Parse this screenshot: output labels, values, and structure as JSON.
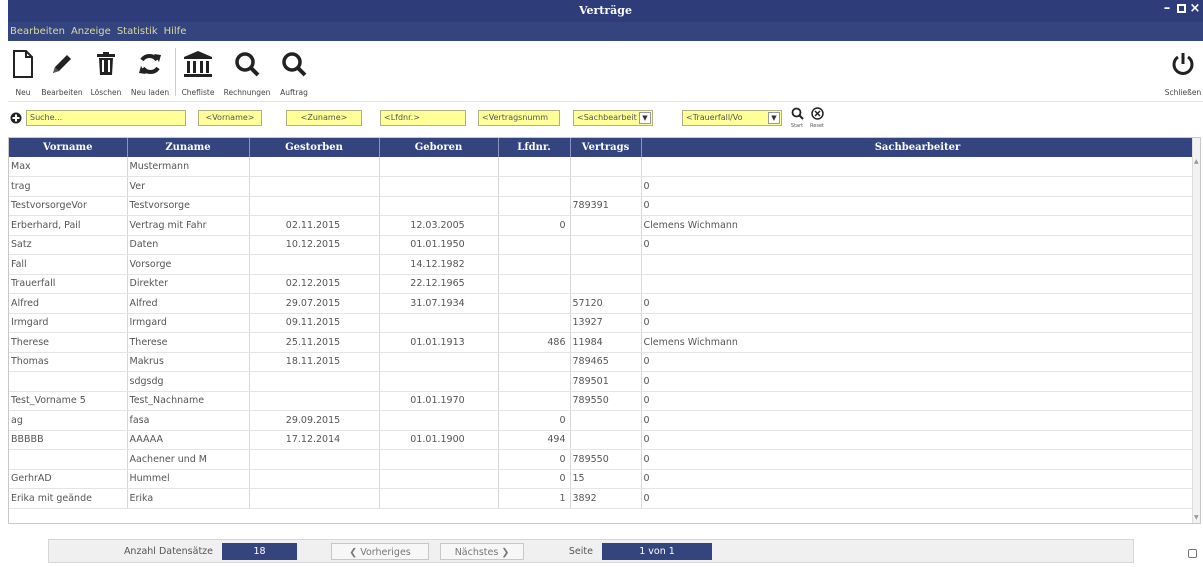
{
  "window": {
    "title": "Verträge"
  },
  "menu": [
    "Bearbeiten",
    "Anzeige",
    "Statistik",
    "Hilfe"
  ],
  "toolbar": {
    "new": "Neu",
    "edit": "Bearbeiten",
    "delete": "Löschen",
    "reload": "Neu laden",
    "chefliste": "Chefliste",
    "rechnungen": "Rechnungen",
    "auftrag": "Auftrag",
    "close": "Schließen"
  },
  "filters": {
    "search": "Suche...",
    "vorname": "<Vorname>",
    "zuname": "<Zuname>",
    "lfdnr": "<Lfdnr.>",
    "vertragsnummer": "<Vertragsnumm",
    "sachbearbeiter": "<Sachbearbeit",
    "trauerfall": "<Trauerfall/Vo",
    "start": "Start",
    "reset": "Reset"
  },
  "table": {
    "headers": [
      "Vorname",
      "Zuname",
      "Gestorben",
      "Geboren",
      "Lfdnr.",
      "Vertrags",
      "Sachbearbeiter"
    ],
    "rows": [
      [
        "Max",
        "Mustermann",
        "",
        "",
        "",
        "",
        ""
      ],
      [
        "trag",
        "Ver",
        "",
        "",
        "",
        "",
        "0"
      ],
      [
        "TestvorsorgeVor",
        "Testvorsorge",
        "",
        "",
        "",
        "789391",
        "0"
      ],
      [
        "Erberhard, Pail",
        "Vertrag mit Fahr",
        "02.11.2015",
        "12.03.2005",
        "0",
        "",
        "Clemens Wichmann"
      ],
      [
        "Satz",
        "Daten",
        "10.12.2015",
        "01.01.1950",
        "",
        "",
        "0"
      ],
      [
        "Fall",
        "Vorsorge",
        "",
        "14.12.1982",
        "",
        "",
        ""
      ],
      [
        "Trauerfall",
        "Direkter",
        "02.12.2015",
        "22.12.1965",
        "",
        "",
        ""
      ],
      [
        "Alfred",
        "Alfred",
        "29.07.2015",
        "31.07.1934",
        "",
        "57120",
        "0"
      ],
      [
        "Irmgard",
        "Irmgard",
        "09.11.2015",
        "",
        "",
        "13927",
        "0"
      ],
      [
        "Therese",
        "Therese",
        "25.11.2015",
        "01.01.1913",
        "486",
        "11984",
        "Clemens Wichmann"
      ],
      [
        "Thomas",
        "Makrus",
        "18.11.2015",
        "",
        "",
        "789465",
        "0"
      ],
      [
        "",
        "sdgsdg",
        "",
        "",
        "",
        "789501",
        "0"
      ],
      [
        "Test_Vorname 5",
        "Test_Nachname",
        "",
        "01.01.1970",
        "",
        "789550",
        "0"
      ],
      [
        "ag",
        "fasa",
        "29.09.2015",
        "",
        "0",
        "",
        "0"
      ],
      [
        "BBBBB",
        "AAAAA",
        "17.12.2014",
        "01.01.1900",
        "494",
        "",
        "0"
      ],
      [
        "",
        "Aachener und M",
        "",
        "",
        "0",
        "789550",
        "0"
      ],
      [
        "GerhrAD",
        "Hummel",
        "",
        "",
        "0",
        "15",
        "0"
      ],
      [
        "Erika mit geände",
        "Erika",
        "",
        "",
        "1",
        "3892",
        "0"
      ]
    ]
  },
  "footer": {
    "count_label": "Anzahl Datensätze",
    "count_value": "18",
    "prev": "❮ Vorheriges",
    "next": "Nächstes ❯",
    "page_label": "Seite",
    "page_value": "1 von 1"
  },
  "colors": {
    "titlebar": "#2e3d7a",
    "header": "#34447f",
    "filter_bg": "#ffff99",
    "menu_text": "#d9d9a0"
  }
}
